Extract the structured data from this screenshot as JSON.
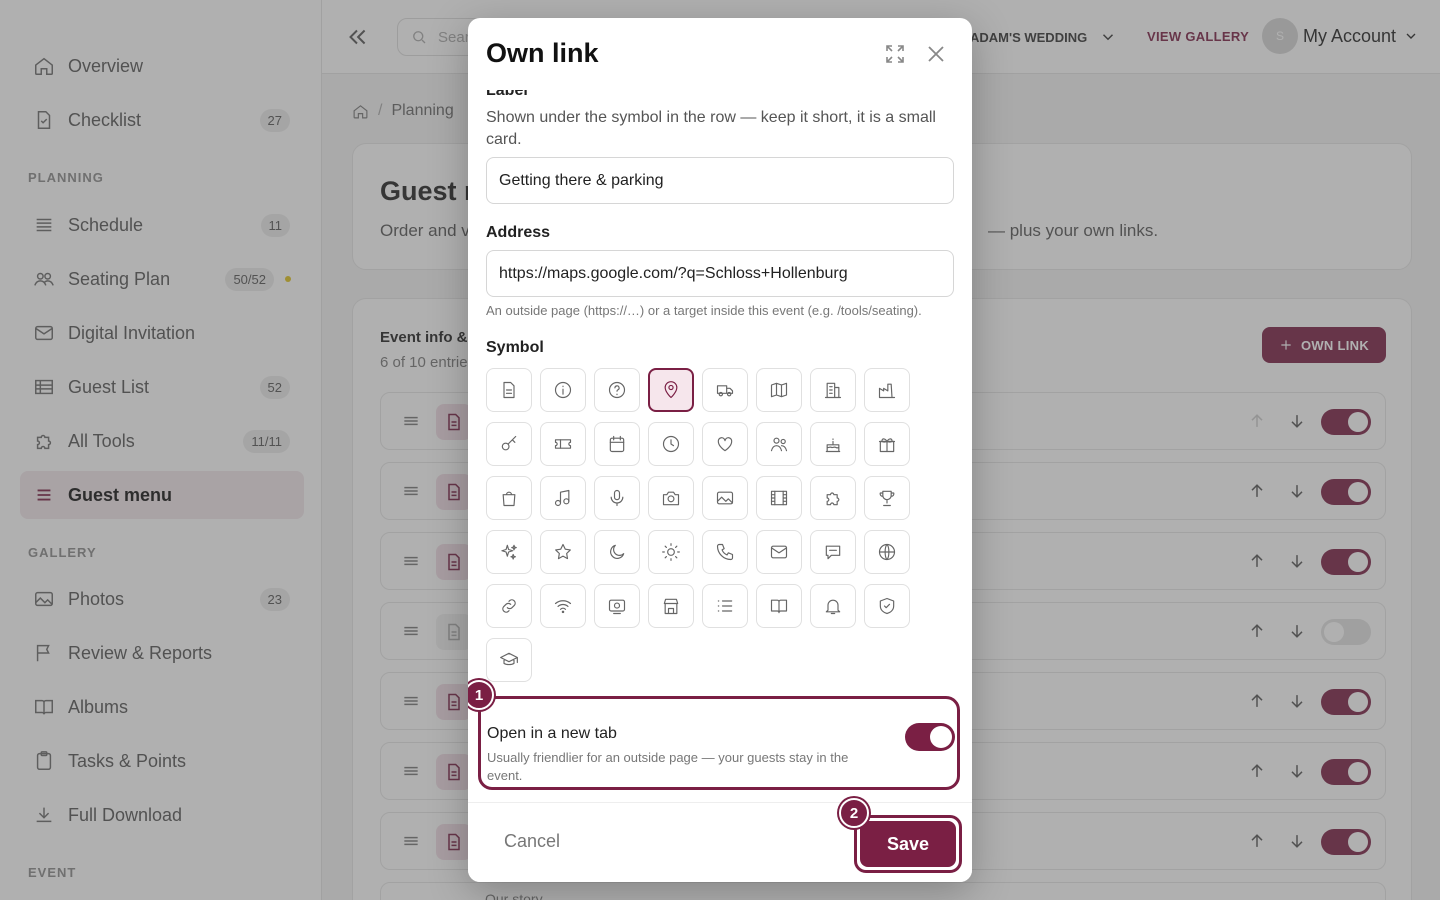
{
  "sidebar": {
    "items": [
      {
        "label": "Overview",
        "icon": "home-icon",
        "badge": ""
      },
      {
        "label": "Checklist",
        "icon": "checklist-icon",
        "badge": "27"
      },
      {
        "label": "Schedule",
        "icon": "schedule-icon",
        "badge": "11"
      },
      {
        "label": "Seating Plan",
        "icon": "users-icon",
        "badge": "50/52"
      },
      {
        "label": "Digital Invitation",
        "icon": "mail-icon",
        "badge": ""
      },
      {
        "label": "Guest List",
        "icon": "table-icon",
        "badge": "52"
      },
      {
        "label": "All Tools",
        "icon": "puzzle-icon",
        "badge": "11/11"
      },
      {
        "label": "Guest menu",
        "icon": "menu-icon",
        "badge": ""
      },
      {
        "label": "Photos",
        "icon": "image-icon",
        "badge": "23"
      },
      {
        "label": "Review & Reports",
        "icon": "flag-icon",
        "badge": ""
      },
      {
        "label": "Albums",
        "icon": "book-icon",
        "badge": ""
      },
      {
        "label": "Tasks & Points",
        "icon": "clipboard-icon",
        "badge": ""
      },
      {
        "label": "Full Download",
        "icon": "download-icon",
        "badge": ""
      }
    ],
    "sections": {
      "planning": "PLANNING",
      "gallery": "GALLERY",
      "event": "EVENT"
    },
    "active_item": "Guest menu",
    "notification_dot_color": "#e1c31d"
  },
  "topbar": {
    "search_placeholder": "Sear",
    "event_name": "ADAM'S WEDDING",
    "view_gallery": "VIEW GALLERY",
    "avatar_initial": "S",
    "account_label": "My Account"
  },
  "main": {
    "breadcrumb": "Planning",
    "title": "Guest m",
    "subtitle_left": "Order and v",
    "subtitle_right": "— plus your own links.",
    "list_title": "Event info &",
    "list_count": "6 of 10 entrie",
    "own_link_button": "OWN LINK",
    "rows": [
      {
        "enabled": true,
        "up_disabled": true
      },
      {
        "enabled": true,
        "up_disabled": false
      },
      {
        "enabled": true,
        "up_disabled": false
      },
      {
        "enabled": false,
        "up_disabled": false
      },
      {
        "enabled": true,
        "up_disabled": false
      },
      {
        "enabled": true,
        "up_disabled": false
      },
      {
        "enabled": true,
        "up_disabled": false
      }
    ],
    "peek_text": "Our story"
  },
  "modal": {
    "title": "Own link",
    "label_heading": "Label",
    "label_help": "Shown under the symbol in the row — keep it short, it is a small card.",
    "label_value": "Getting there & parking",
    "address_heading": "Address",
    "address_value": "https://maps.google.com/?q=Schloss+Hollenburg",
    "address_hint": "An outside page (https://…) or a target inside this event (e.g. /tools/seating).",
    "symbol_heading": "Symbol",
    "symbols": [
      "document",
      "info",
      "help",
      "map-pin",
      "truck",
      "map",
      "building",
      "factory",
      "key",
      "ticket",
      "calendar",
      "clock",
      "heart",
      "users",
      "cake",
      "gift",
      "bag",
      "music",
      "microphone",
      "camera",
      "image",
      "film",
      "puzzle",
      "trophy",
      "sparkles",
      "star",
      "moon",
      "sun",
      "phone",
      "mail",
      "chat",
      "globe",
      "link",
      "wifi",
      "projector",
      "store",
      "list",
      "book",
      "bell",
      "shield",
      "graduation-cap"
    ],
    "selected_symbol": "map-pin",
    "new_tab_title": "Open in a new tab",
    "new_tab_help": "Usually friendlier for an outside page — your guests stay in the event.",
    "new_tab_enabled": true,
    "cancel_label": "Cancel",
    "save_label": "Save",
    "step_1": "1",
    "step_2": "2"
  },
  "colors": {
    "accent": "#7a1f44",
    "accent_light": "#f6e6ec"
  }
}
